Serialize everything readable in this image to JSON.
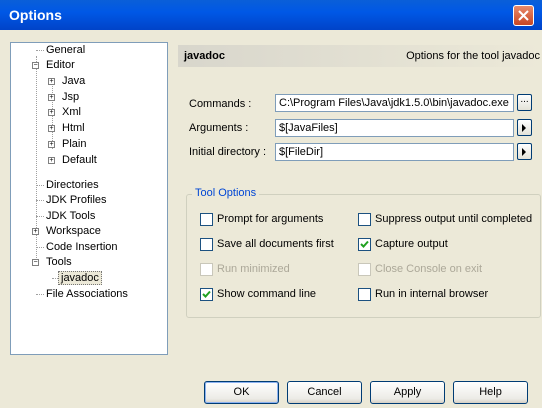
{
  "window": {
    "title": "Options"
  },
  "tree": {
    "items": [
      {
        "label": "General"
      },
      {
        "label": "Editor",
        "expanded": true
      },
      {
        "label": "Java",
        "expander": "+"
      },
      {
        "label": "Jsp",
        "expander": "+"
      },
      {
        "label": "Xml",
        "expander": "+"
      },
      {
        "label": "Html",
        "expander": "+"
      },
      {
        "label": "Plain",
        "expander": "+"
      },
      {
        "label": "Default",
        "expander": "+"
      },
      {
        "label": "Directories"
      },
      {
        "label": "JDK Profiles"
      },
      {
        "label": "JDK Tools"
      },
      {
        "label": "Workspace",
        "expander": "+"
      },
      {
        "label": "Code Insertion"
      },
      {
        "label": "Tools",
        "expanded": true
      },
      {
        "label": "javadoc",
        "selected": true
      },
      {
        "label": "File Associations"
      }
    ],
    "expander_minus": "−",
    "expander_plus": "+"
  },
  "panel": {
    "header_left": "javadoc",
    "header_right": "Options for the tool javadoc",
    "commands_label": "Commands :",
    "commands_value": "C:\\Program Files\\Java\\jdk1.5.0\\bin\\javadoc.exe",
    "browse_label": "...",
    "arguments_label": "Arguments :",
    "arguments_value": "$[JavaFiles]",
    "initdir_label": "Initial directory :",
    "initdir_value": "$[FileDir]"
  },
  "tool_options": {
    "title": "Tool Options",
    "checkboxes": [
      {
        "label": "Prompt for arguments",
        "checked": false,
        "enabled": true
      },
      {
        "label": "Suppress output until completed",
        "checked": false,
        "enabled": true
      },
      {
        "label": "Save all documents first",
        "checked": false,
        "enabled": true
      },
      {
        "label": "Capture output",
        "checked": true,
        "enabled": true
      },
      {
        "label": "Run minimized",
        "checked": false,
        "enabled": false
      },
      {
        "label": "Close Console on exit",
        "checked": false,
        "enabled": false
      },
      {
        "label": "Show command line",
        "checked": true,
        "enabled": true
      },
      {
        "label": "Run in internal browser",
        "checked": false,
        "enabled": true
      }
    ]
  },
  "buttons": {
    "ok": "OK",
    "cancel": "Cancel",
    "apply": "Apply",
    "help": "Help"
  },
  "colors": {
    "title_bar": "#0058e6",
    "close_button": "#d9542b",
    "group_title": "#0046d5"
  }
}
